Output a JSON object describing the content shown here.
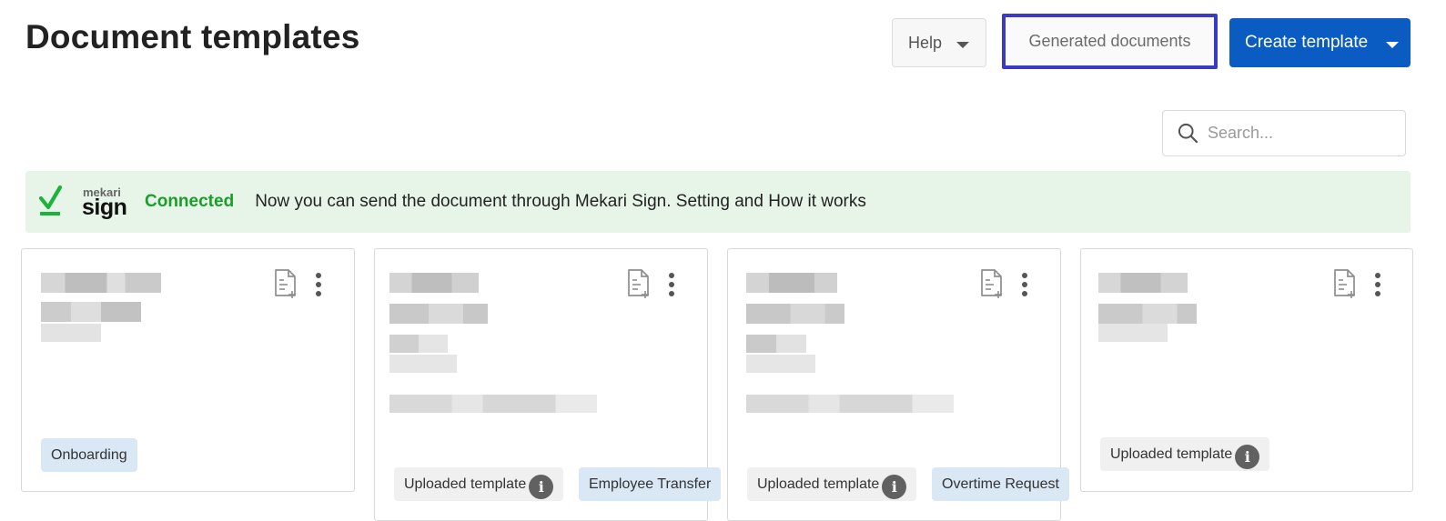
{
  "header": {
    "title": "Document templates",
    "help_label": "Help",
    "generated_label": "Generated documents",
    "create_label": "Create template"
  },
  "search": {
    "placeholder": "Search..."
  },
  "banner": {
    "logo_small": "mekari",
    "logo_main": "sign",
    "status": "Connected",
    "message": "Now you can send the document through Mekari Sign. Setting and How it works",
    "status_color": "#1a9e2a",
    "background": "#e7f5e9"
  },
  "cards": [
    {
      "tags": [
        {
          "label": "Onboarding",
          "style": "category"
        }
      ]
    },
    {
      "tags": [
        {
          "label": "Uploaded template",
          "style": "uploaded"
        },
        {
          "label": "Employee Transfer",
          "style": "category"
        }
      ]
    },
    {
      "tags": [
        {
          "label": "Uploaded template",
          "style": "uploaded"
        },
        {
          "label": "Overtime Request",
          "style": "category"
        }
      ]
    },
    {
      "tags": [
        {
          "label": "Uploaded template",
          "style": "uploaded"
        }
      ]
    }
  ],
  "icons": {
    "card_actions": [
      "add-document-icon",
      "more-vertical-icon"
    ],
    "info": "info-icon",
    "search": "search-icon"
  },
  "colors": {
    "primary": "#0b5cc2",
    "highlight_border": "#3b3ac4",
    "tag_blue": "#dae7f5",
    "tag_grey": "#f0f0f0"
  }
}
